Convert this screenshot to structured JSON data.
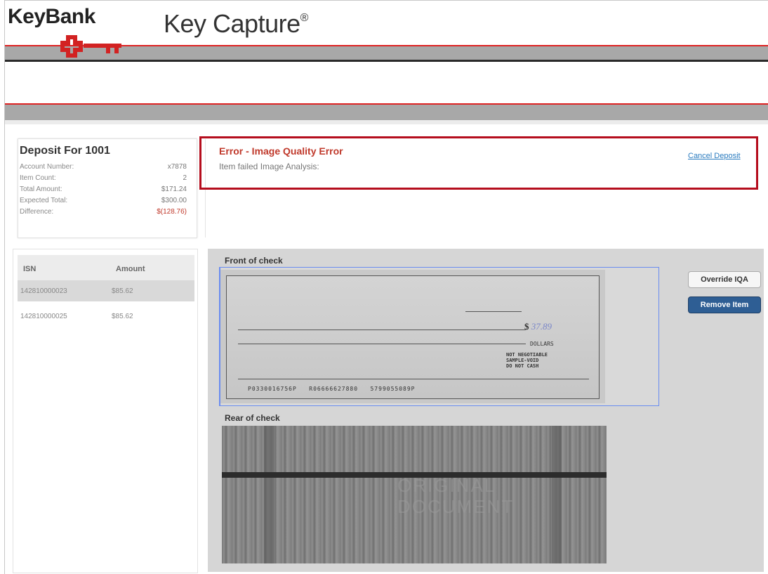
{
  "header": {
    "brand": "KeyBank",
    "app_title": "Key Capture",
    "app_title_mark": "®"
  },
  "summary": {
    "title": "Deposit For 1001",
    "rows": [
      {
        "label": "Account Number:",
        "value": "x7878"
      },
      {
        "label": "Item Count:",
        "value": "2"
      },
      {
        "label": "Total Amount:",
        "value": "$171.24"
      },
      {
        "label": "Expected Total:",
        "value": "$300.00"
      },
      {
        "label": "Difference:",
        "value": "$(128.76)"
      }
    ]
  },
  "error": {
    "title": "Error - Image Quality Error",
    "message": "Item failed Image Analysis:",
    "cancel_link": "Cancel Deposit"
  },
  "items": {
    "headers": [
      "ISN",
      "Amount"
    ],
    "rows": [
      {
        "isn": "142810000023",
        "amount": "$85.62",
        "selected": true
      },
      {
        "isn": "142810000025",
        "amount": "$85.62",
        "selected": false
      }
    ]
  },
  "images": {
    "front_label": "Front of check",
    "rear_label": "Rear of check",
    "front_check": {
      "amount_prefix": "$",
      "amount": "37.89",
      "dollars_text": "DOLLARS",
      "stamp": "NOT NEGOTIABLE\nSAMPLE-VOID\nDO NOT CASH",
      "micr": "P0330016756P   R06666627880   5799055089P"
    },
    "rear_watermark_1": "ORIGINAL",
    "rear_watermark_2": "DOCUMENT"
  },
  "actions": {
    "override_label": "Override IQA",
    "remove_label": "Remove Item"
  },
  "colors": {
    "brand_red": "#d22222",
    "error_red": "#c0392b",
    "error_border": "#b50d1d",
    "link_blue": "#2a7bbf",
    "remove_button_blue": "#2e5e94"
  }
}
